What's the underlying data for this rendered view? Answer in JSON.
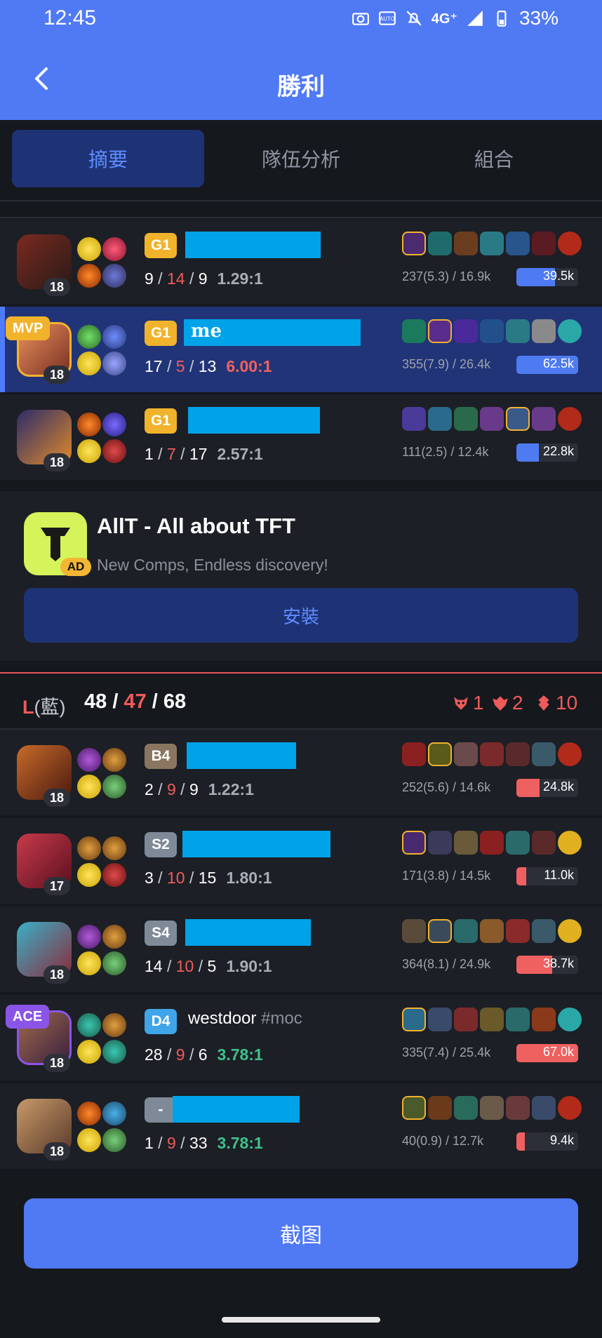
{
  "status": {
    "time": "12:45",
    "network": "4G⁺",
    "battery": "33%"
  },
  "header": {
    "title": "勝利"
  },
  "tabs": [
    {
      "label": "摘要",
      "active": true
    },
    {
      "label": "隊伍分析",
      "active": false
    },
    {
      "label": "組合",
      "active": false
    }
  ],
  "team_win": {
    "players": [
      {
        "level": "18",
        "rank": "G1",
        "rank_color": "#f1b32c",
        "name": "",
        "tag": "",
        "badge": "",
        "k": "9",
        "d": "14",
        "a": "9",
        "ratio": "1.29:1",
        "ratio_style": "gray",
        "cs": "237(5.3) / 16.9k",
        "damage": "39.5k",
        "damage_fraction": 0.63
      },
      {
        "level": "18",
        "rank": "G1",
        "rank_color": "#f1b32c",
        "name": "me",
        "tag": "",
        "badge": "MVP",
        "k": "17",
        "d": "5",
        "a": "13",
        "ratio": "6.00:1",
        "ratio_style": "red",
        "cs": "355(7.9) / 26.4k",
        "damage": "62.5k",
        "damage_fraction": 1.0
      },
      {
        "level": "18",
        "rank": "G1",
        "rank_color": "#f1b32c",
        "name": "",
        "tag": "",
        "badge": "",
        "k": "1",
        "d": "7",
        "a": "17",
        "ratio": "2.57:1",
        "ratio_style": "gray",
        "cs": "111(2.5) / 12.4k",
        "damage": "22.8k",
        "damage_fraction": 0.36
      }
    ]
  },
  "ad": {
    "title": "AllT - All about TFT",
    "subtitle": "New Comps, Endless discovery!",
    "badge": "AD",
    "install_label": "安裝"
  },
  "team_lose": {
    "label_prefix": "L",
    "label_side": "(藍)",
    "kills": "48",
    "deaths": "47",
    "assists": "68",
    "objectives": [
      {
        "icon": "baron-icon",
        "count": "1"
      },
      {
        "icon": "dragon-icon",
        "count": "2"
      },
      {
        "icon": "tower-icon",
        "count": "10"
      }
    ],
    "players": [
      {
        "level": "18",
        "rank": "B4",
        "rank_color": "#8a7660",
        "name": "",
        "tag": "",
        "badge": "",
        "k": "2",
        "d": "9",
        "a": "9",
        "ratio": "1.22:1",
        "ratio_style": "gray",
        "cs": "252(5.6) / 14.6k",
        "damage": "24.8k",
        "damage_fraction": 0.37
      },
      {
        "level": "17",
        "rank": "S2",
        "rank_color": "#7f8a98",
        "name": "",
        "tag": "",
        "badge": "",
        "k": "3",
        "d": "10",
        "a": "15",
        "ratio": "1.80:1",
        "ratio_style": "gray",
        "cs": "171(3.8) / 14.5k",
        "damage": "11.0k",
        "damage_fraction": 0.16
      },
      {
        "level": "18",
        "rank": "S4",
        "rank_color": "#7f8a98",
        "name": "",
        "tag": "",
        "badge": "",
        "k": "14",
        "d": "10",
        "a": "5",
        "ratio": "1.90:1",
        "ratio_style": "gray",
        "cs": "364(8.1) / 24.9k",
        "damage": "38.7k",
        "damage_fraction": 0.58
      },
      {
        "level": "18",
        "rank": "D4",
        "rank_color": "#3fa4e8",
        "name": "westdoor",
        "tag": "#moc",
        "badge": "ACE",
        "k": "28",
        "d": "9",
        "a": "6",
        "ratio": "3.78:1",
        "ratio_style": "green",
        "cs": "335(7.4) / 25.4k",
        "damage": "67.0k",
        "damage_fraction": 1.0
      },
      {
        "level": "18",
        "rank": "-",
        "rank_color": "#7f8a98",
        "name": "",
        "tag": "",
        "badge": "",
        "k": "1",
        "d": "9",
        "a": "33",
        "ratio": "3.78:1",
        "ratio_style": "green",
        "cs": "40(0.9) / 12.7k",
        "damage": "9.4k",
        "damage_fraction": 0.14
      }
    ]
  },
  "footer": {
    "screenshot_label": "截图"
  },
  "colors": {
    "accent": "#5079f4",
    "mvp_row": "#213477",
    "loss_red": "#ef5a5a",
    "win_blue": "#4f7bf2"
  }
}
